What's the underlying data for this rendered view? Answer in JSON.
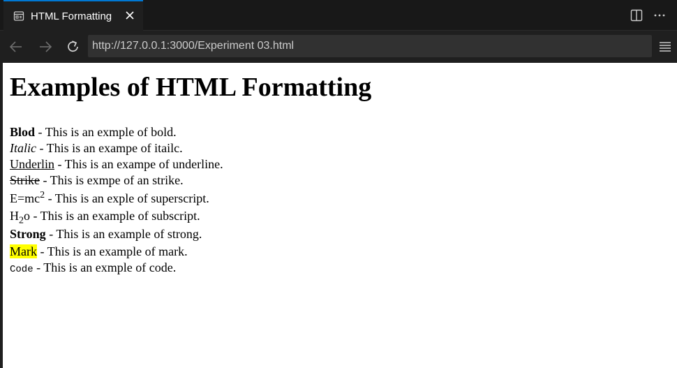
{
  "tab": {
    "title": "HTML Formatting"
  },
  "navigation": {
    "url": "http://127.0.0.1:3000/Experiment 03.html"
  },
  "page": {
    "title": "Examples of HTML Formatting",
    "examples": [
      {
        "term": "Blod",
        "desc": " - This is an exmple of bold."
      },
      {
        "term": "Italic",
        "desc": " - This is an exampe of itailc."
      },
      {
        "term": "Underlin",
        "desc": " - This is an exampe of underline."
      },
      {
        "term": "Strike",
        "desc": " - This is exmpe of an strike."
      },
      {
        "term": "E=mc",
        "sup": "2",
        "desc": " - This is an exple of superscript."
      },
      {
        "term": "H",
        "sub": "2",
        "term_after": "o",
        "desc": " - This is an example of subscript."
      },
      {
        "term": "Strong",
        "desc": " - This is an example of strong."
      },
      {
        "term": "Mark",
        "desc": " - This is an example of mark."
      },
      {
        "term": "Code",
        "desc": " - This is an exmple of code."
      }
    ]
  },
  "colors": {
    "tab_accent": "#0078d4",
    "editor_bg": "#1f1f1f",
    "mark_highlight": "#ffff00"
  },
  "icons": [
    "preview-icon",
    "close-icon",
    "split-editor-icon",
    "more-actions-icon",
    "back-arrow-icon",
    "forward-arrow-icon",
    "reload-icon",
    "menu-icon"
  ]
}
